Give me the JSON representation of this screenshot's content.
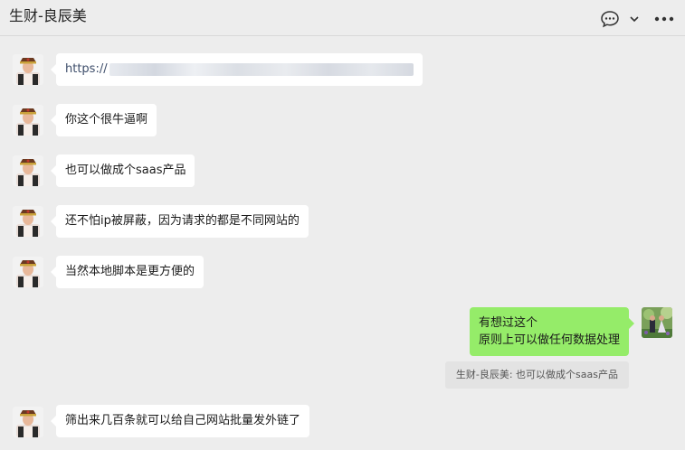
{
  "header": {
    "title": "生财-良辰美"
  },
  "messages": [
    {
      "side": "left",
      "prefix": "https://"
    },
    {
      "side": "left",
      "text": "你这个很牛逼啊"
    },
    {
      "side": "left",
      "text": "也可以做成个saas产品"
    },
    {
      "side": "left",
      "text": "还不怕ip被屏蔽，因为请求的都是不同网站的"
    },
    {
      "side": "left",
      "text": "当然本地脚本是更方便的"
    },
    {
      "side": "right",
      "lines": [
        "有想过这个",
        "原则上可以做任何数据处理"
      ]
    },
    {
      "side": "left",
      "text": "筛出来几百条就可以给自己网站批量发外链了"
    }
  ],
  "quote": {
    "text": "生财-良辰美: 也可以做成个saas产品"
  },
  "icons": [
    "chat-icon",
    "chevron-down-icon",
    "more-icon"
  ],
  "colors": {
    "background": "#ededed",
    "bubble_left": "#ffffff",
    "bubble_right": "#95ec69",
    "quote_bg": "#e3e3e3"
  }
}
